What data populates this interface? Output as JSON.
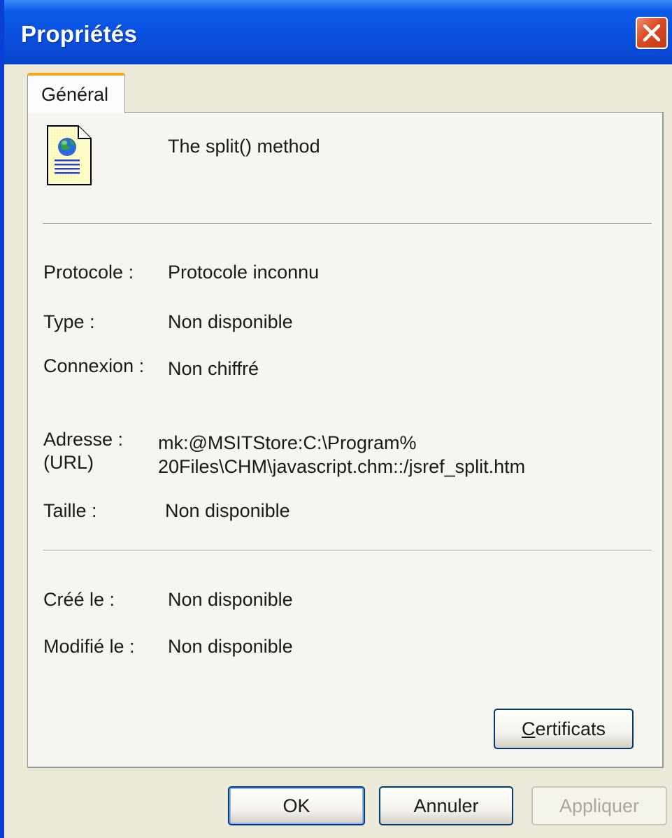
{
  "window": {
    "title": "Propriétés"
  },
  "tabs": [
    {
      "label": "Général",
      "selected": true
    }
  ],
  "general": {
    "page_title": "The split() method",
    "file_icon": "html-document-globe-icon",
    "protocol_label": "Protocole :",
    "protocol_value": "Protocole inconnu",
    "type_label": "Type :",
    "type_value": "Non disponible",
    "connection_label": "Connexion :",
    "connection_value": "Non chiffré",
    "address_label_line1": "Adresse :",
    "address_label_line2": "(URL)",
    "address_value_line1": "mk:@MSITStore:C:\\Program%",
    "address_value_line2": "20Files\\CHM\\javascript.chm::/jsref_split.htm",
    "size_label": "Taille :",
    "size_value": "Non disponible",
    "created_label": "Créé le :",
    "created_value": "Non disponible",
    "modified_label": "Modifié le :",
    "modified_value": "Non disponible",
    "certificates_button": {
      "first_letter": "C",
      "rest": "ertificats"
    }
  },
  "buttons": {
    "ok": "OK",
    "cancel": "Annuler",
    "apply": "Appliquer"
  },
  "colors": {
    "titlebar": "#0a4fdf",
    "close": "#d94b24",
    "tab_highlight": "#f7a319",
    "dialog_bg": "#ece9d8"
  }
}
